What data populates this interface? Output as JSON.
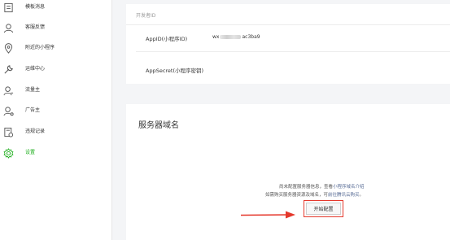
{
  "sidebar": {
    "items": [
      {
        "label": "模板消息",
        "icon": "template-message-icon",
        "active": false
      },
      {
        "label": "客服反馈",
        "icon": "user-feedback-icon",
        "active": false
      },
      {
        "label": "附近的小程序",
        "icon": "location-pin-icon",
        "active": false
      },
      {
        "label": "运维中心",
        "icon": "wrench-icon",
        "active": false
      },
      {
        "label": "流量主",
        "icon": "traffic-user-icon",
        "active": false
      },
      {
        "label": "广告主",
        "icon": "advertiser-icon",
        "active": false
      },
      {
        "label": "违规记录",
        "icon": "violation-record-icon",
        "active": false
      },
      {
        "label": "设置",
        "icon": "settings-gear-icon",
        "active": true
      }
    ],
    "active_color": "#1aad19"
  },
  "developer": {
    "header": "开发者ID",
    "appid_label": "AppID(小程序ID)",
    "appid_prefix": "wx",
    "appid_suffix": "ac3ba9",
    "appsecret_label": "AppSecret(小程序密钥)"
  },
  "server_domain": {
    "title": "服务器域名",
    "hint_line1_text": "尚未配置服务器信息，查看",
    "hint_line1_link": "小程序域名介绍",
    "hint_line2_text": "如需购买服务器资源及域名，可",
    "hint_line2_link": "前往腾讯云购买",
    "hint_line2_end": "。",
    "start_button": "开始配置"
  },
  "annotation": {
    "highlight_color": "#e5382c",
    "link_color": "#576b95"
  }
}
